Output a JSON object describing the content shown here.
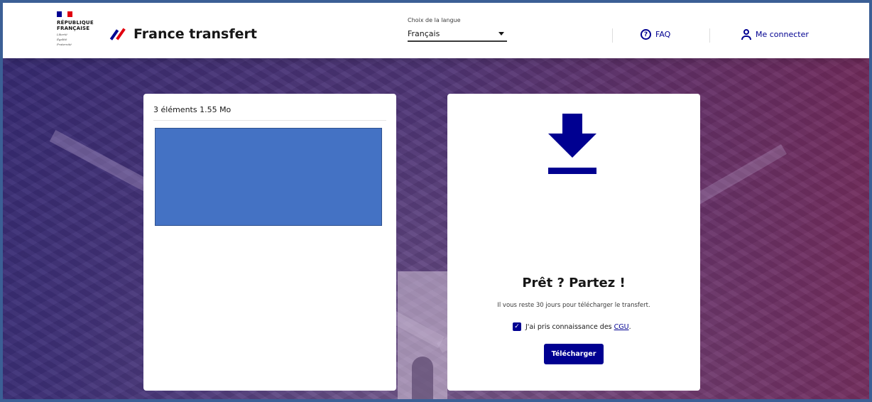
{
  "header": {
    "republique": "RÉPUBLIQUE",
    "francaise": "FRANÇAISE",
    "devise": [
      "Liberté",
      "Égalité",
      "Fraternité"
    ],
    "brand": "France transfert",
    "language_label": "Choix de la langue",
    "language_value": "Français",
    "faq": "FAQ",
    "login": "Me connecter"
  },
  "files": {
    "summary": "3 éléments 1.55 Mo"
  },
  "download": {
    "title": "Prêt ? Partez !",
    "subtitle": "Il vous reste 30 jours pour télécharger le transfert.",
    "consent_text": "J'ai pris connaissance des",
    "consent_link": "CGU",
    "consent_suffix": ".",
    "consent_checked": true,
    "button": "Télécharger"
  },
  "icons": {
    "faq": "question-circle-icon",
    "login": "user-icon",
    "download": "download-arrow-icon",
    "language": "chevron-down-icon"
  },
  "colors": {
    "primary": "#000091",
    "marianne_red": "#e1000f",
    "redaction_box": "#4472c4",
    "frame_border": "#3b5f95"
  }
}
